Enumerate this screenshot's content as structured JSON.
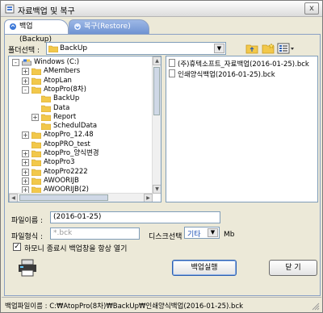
{
  "window": {
    "title": "자료백업 및 복구",
    "close_label": "x"
  },
  "tabs": [
    {
      "label": "백업(Backup)",
      "active": true
    },
    {
      "label": "복구(Restore)",
      "active": false
    }
  ],
  "folder_select": {
    "label": "폴더선택 :",
    "value": "BackUp"
  },
  "tree": [
    {
      "label": "Windows (C:)",
      "level": 0,
      "expander": "-",
      "icon": "drive-icon"
    },
    {
      "label": "AMembers",
      "level": 1,
      "expander": "+"
    },
    {
      "label": "AtopLan",
      "level": 1,
      "expander": "+"
    },
    {
      "label": "AtopPro(8차)",
      "level": 1,
      "expander": "-"
    },
    {
      "label": "BackUp",
      "level": 2,
      "expander": "",
      "open": true
    },
    {
      "label": "Data",
      "level": 2,
      "expander": ""
    },
    {
      "label": "Report",
      "level": 2,
      "expander": "+"
    },
    {
      "label": "SchedulData",
      "level": 2,
      "expander": ""
    },
    {
      "label": "AtopPro_12.48",
      "level": 1,
      "expander": "+"
    },
    {
      "label": "AtopPRO_test",
      "level": 1,
      "expander": ""
    },
    {
      "label": "AtopPro_양식변경",
      "level": 1,
      "expander": "+"
    },
    {
      "label": "AtopPro3",
      "level": 1,
      "expander": "+"
    },
    {
      "label": "AtopPro2222",
      "level": 1,
      "expander": "+"
    },
    {
      "label": "AWOORIJB",
      "level": 1,
      "expander": "+"
    },
    {
      "label": "AWOORIJB(2)",
      "level": 1,
      "expander": "+"
    }
  ],
  "files": [
    {
      "name": "(주)휴텍소프트_자료백업(2016-01-25).bck"
    },
    {
      "name": "인쇄양식백업(2016-01-25).bck"
    }
  ],
  "form": {
    "filename_label": "파일이름 :",
    "filename_value": "(2016-01-25)",
    "filetype_label": "파일형식 :",
    "filetype_placeholder": "*.bck",
    "disk_label": "디스크선택",
    "disk_value": "기타",
    "disk_unit": "Mb",
    "harmony_checkbox_label": "하모니 종료시 백업창을 항상 열기",
    "harmony_checked": true
  },
  "buttons": {
    "run_backup": "백업실행",
    "close": "닫 기"
  },
  "status": {
    "text": "백업파일이름 : C:₩AtopPro(8차)₩BackUp₩인쇄양식백업(2016-01-25).bck"
  },
  "colors": {
    "folder": "#f2c84b",
    "tab_active": "#ffffff",
    "tab_inactive": "#7a9ad6",
    "accent": "#2a5db0"
  }
}
